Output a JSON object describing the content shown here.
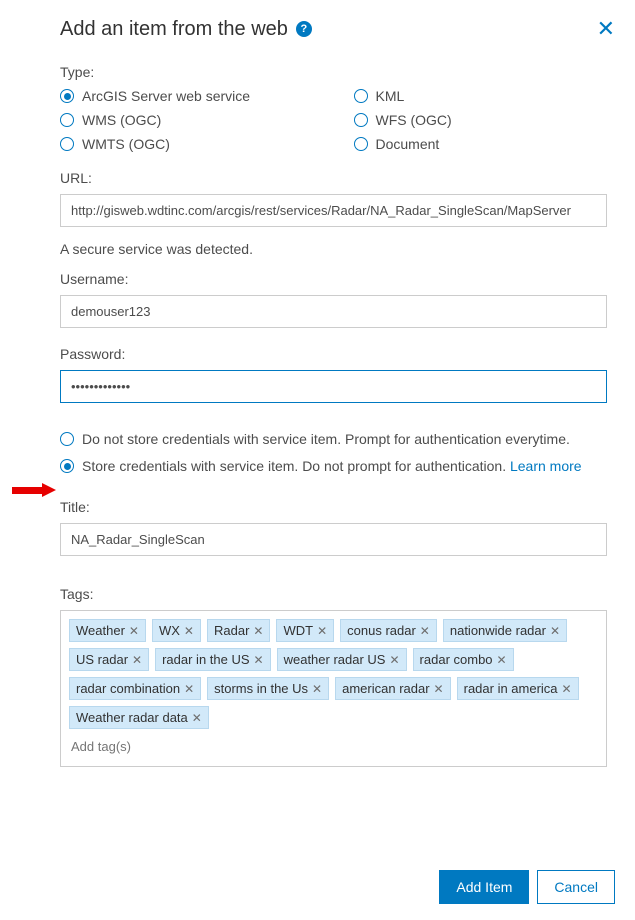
{
  "header": {
    "title": "Add an item from the web"
  },
  "type": {
    "label": "Type:",
    "options": [
      {
        "label": "ArcGIS Server web service",
        "selected": true,
        "name": "type-arcgis-server"
      },
      {
        "label": "KML",
        "selected": false,
        "name": "type-kml"
      },
      {
        "label": "WMS (OGC)",
        "selected": false,
        "name": "type-wms"
      },
      {
        "label": "WFS (OGC)",
        "selected": false,
        "name": "type-wfs"
      },
      {
        "label": "WMTS (OGC)",
        "selected": false,
        "name": "type-wmts"
      },
      {
        "label": "Document",
        "selected": false,
        "name": "type-document"
      }
    ]
  },
  "url": {
    "label": "URL:",
    "value": "http://gisweb.wdtinc.com/arcgis/rest/services/Radar/NA_Radar_SingleScan/MapServer"
  },
  "secure_message": "A secure service was detected.",
  "username": {
    "label": "Username:",
    "value": "demouser123"
  },
  "password": {
    "label": "Password:",
    "value": "•••••••••••••"
  },
  "credentials": {
    "option_nostore": "Do not store credentials with service item. Prompt for authentication everytime.",
    "option_store_prefix": "Store credentials with service item. Do not prompt for authentication. ",
    "learn_more": "Learn more",
    "selected": "store"
  },
  "title_field": {
    "label": "Title:",
    "value": "NA_Radar_SingleScan"
  },
  "tags": {
    "label": "Tags:",
    "placeholder": "Add tag(s)",
    "items": [
      "Weather",
      "WX",
      "Radar",
      "WDT",
      "conus radar",
      "nationwide radar",
      "US radar",
      "radar in the US",
      "weather radar US",
      "radar combo",
      "radar combination",
      "storms in the Us",
      "american radar",
      "radar in america",
      "Weather radar data"
    ]
  },
  "footer": {
    "add": "Add Item",
    "cancel": "Cancel"
  }
}
